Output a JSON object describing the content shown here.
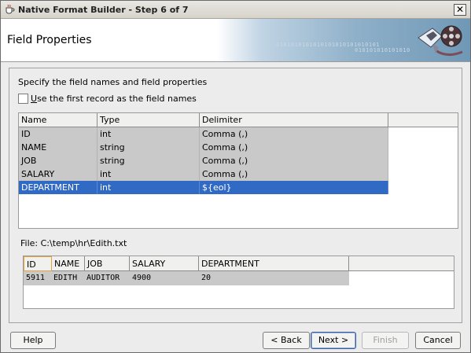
{
  "window": {
    "title": "Native Format Builder - Step 6 of 7",
    "close_glyph": "✕"
  },
  "header": {
    "title": "Field Properties",
    "binary_line1": "0101010101010101010101010101",
    "binary_line2": "010101010101010"
  },
  "instructions": "Specify the field names and field properties",
  "first_record_checkbox": {
    "label_underlined": "U",
    "label_rest": "se the first record as the field names",
    "checked": false
  },
  "fields_table": {
    "columns": [
      "Name",
      "Type",
      "Delimiter"
    ],
    "rows": [
      {
        "name": "ID",
        "type": "int",
        "delimiter": "Comma (,)"
      },
      {
        "name": "NAME",
        "type": "string",
        "delimiter": "Comma (,)"
      },
      {
        "name": "JOB",
        "type": "string",
        "delimiter": "Comma (,)"
      },
      {
        "name": "SALARY",
        "type": "int",
        "delimiter": "Comma (,)"
      },
      {
        "name": "DEPARTMENT",
        "type": "int",
        "delimiter": "${eol}"
      }
    ],
    "selected_row": 4
  },
  "file": {
    "label": "File: C:\\temp\\hr\\Edith.txt"
  },
  "preview_table": {
    "columns": [
      "ID",
      "NAME",
      "JOB",
      "SALARY",
      "DEPARTMENT"
    ],
    "row": [
      "5911",
      "EDITH",
      "AUDITOR",
      "4900",
      "20"
    ]
  },
  "buttons": {
    "help": "Help",
    "back": "< Back",
    "next": "Next >",
    "finish": "Finish",
    "cancel": "Cancel"
  },
  "colors": {
    "selection": "#316ac5",
    "row_fill": "#c9c9c9"
  }
}
